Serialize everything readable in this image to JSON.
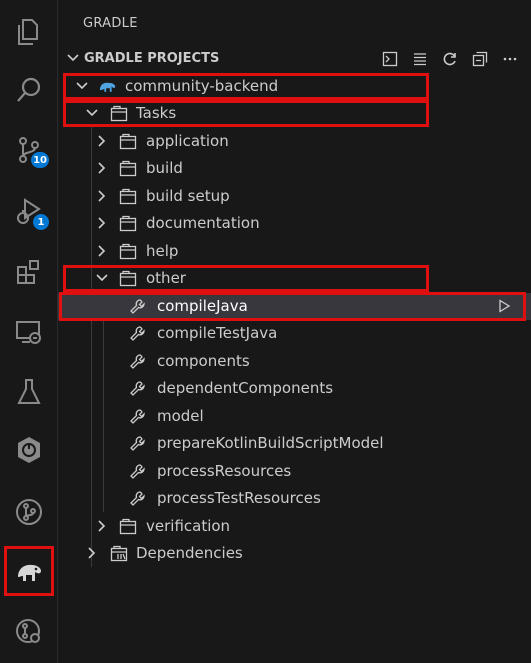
{
  "panel_title": "GRADLE",
  "section_title": "GRADLE PROJECTS",
  "activity_badges": {
    "source_control": "10",
    "run_debug": "1"
  },
  "tree": {
    "project": "community-backend",
    "tasks": "Tasks",
    "groups": [
      "application",
      "build",
      "build setup",
      "documentation",
      "help"
    ],
    "other": "other",
    "other_tasks": [
      "compileJava",
      "compileTestJava",
      "components",
      "dependentComponents",
      "model",
      "prepareKotlinBuildScriptModel",
      "processResources",
      "processTestResources"
    ],
    "verification": "verification",
    "dependencies": "Dependencies"
  },
  "icons": {
    "activity": [
      "explorer-icon",
      "search-icon",
      "source-control-icon",
      "run-debug-icon",
      "extensions-icon",
      "remote-explorer-icon",
      "testing-icon",
      "spring-boot-icon",
      "git-graph-icon",
      "gradle-elephant-icon",
      "gitlens-icon"
    ],
    "header_actions": [
      "terminal-icon",
      "list-icon",
      "refresh-icon",
      "collapse-all-icon",
      "more-icon"
    ]
  },
  "colors": {
    "highlight_box": "#e01010",
    "badge": "#0078d4",
    "elephant": "#4fa3e0"
  }
}
